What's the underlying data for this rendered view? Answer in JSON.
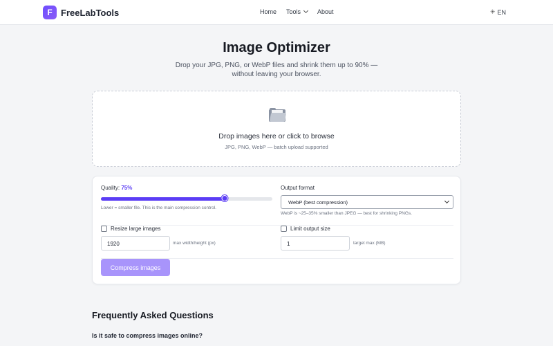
{
  "header": {
    "logo_letter": "F",
    "brand": "FreeLabTools",
    "nav": {
      "home": "Home",
      "tools": "Tools",
      "about": "About"
    },
    "lang_icon": "globe-icon",
    "lang": "EN"
  },
  "hero": {
    "title": "Image Optimizer",
    "subtitle": "Drop your JPG, PNG, or WebP files and shrink them up to 90% — without leaving your browser."
  },
  "dropzone": {
    "icon": "folder-icon",
    "title": "Drop images here or click to browse",
    "subtitle": "JPG, PNG, WebP — batch upload supported"
  },
  "options": {
    "quality_label": "Quality:",
    "quality_value": "75%",
    "quality_fraction": 0.72,
    "quality_hint": "Lower = smaller file. This is the main compression control.",
    "format_label": "Output format",
    "format_selected": "WebP (best compression)",
    "format_hint": "WebP is ~25–35% smaller than JPEG — best for shrinking PNGs.",
    "resize_label": "Resize large images",
    "resize_value": "1920",
    "resize_hint": "max width/height (px)",
    "limit_label": "Limit output size",
    "limit_value": "1",
    "limit_hint": "target max (MB)",
    "compress_button": "Compress images"
  },
  "faq": {
    "title": "Frequently Asked Questions",
    "q1": "Is it safe to compress images online?"
  },
  "colors": {
    "accent": "#5b3df5",
    "button_disabled": "#a894fb"
  }
}
